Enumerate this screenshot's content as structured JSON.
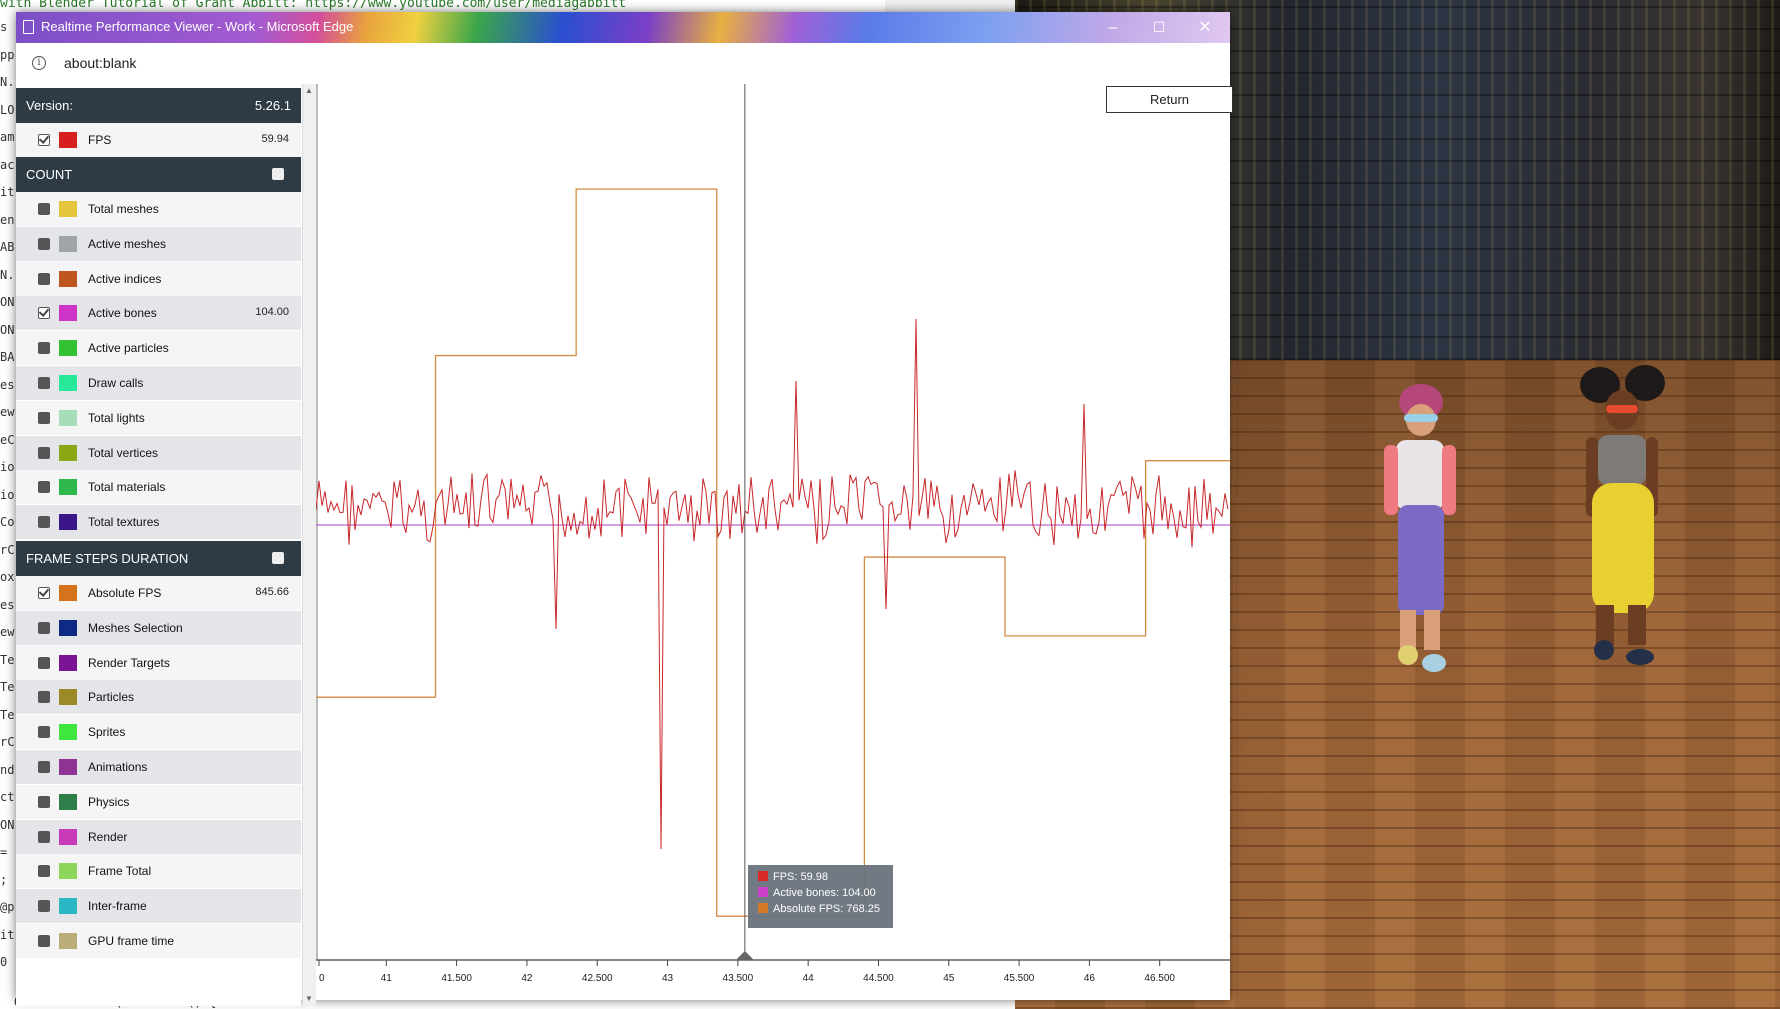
{
  "background": {
    "code_top_line": "with Blender Tutorial of Grant Abbitt: https://www.youtube.com/user/mediagabbitt",
    "code_bottom_line": "Observable.add(function () {",
    "code_left_fragments": [
      "s",
      "pp",
      "N.",
      "LO",
      "am",
      "ac",
      "it",
      "en",
      "AB",
      "N.",
      "ON",
      "ON",
      "BA",
      "es",
      "ew",
      "eC",
      "io",
      "io",
      "Co",
      "rC",
      "ox",
      "es",
      "ew",
      "Te",
      "Te",
      "Te",
      "rC",
      "nd",
      "ct",
      "ON",
      "=",
      ";",
      "@p",
      "it",
      "0"
    ]
  },
  "window": {
    "title": "Realtime Performance Viewer - Work - Microsoft Edge",
    "minimize_glyph": "–",
    "maximize_glyph": "☐",
    "close_glyph": "✕",
    "url": "about:blank",
    "info_glyph": "i"
  },
  "sidebar": {
    "version_label": "Version:",
    "version_value": "5.26.1",
    "fps": {
      "label": "FPS",
      "value": "59.94",
      "color": "#d81f1f",
      "checked": true
    },
    "count_header": "COUNT",
    "count_items": [
      {
        "label": "Total meshes",
        "value": "",
        "color": "#e3c43a",
        "checked": false
      },
      {
        "label": "Active meshes",
        "value": "",
        "color": "#9ea4a8",
        "checked": false
      },
      {
        "label": "Active indices",
        "value": "",
        "color": "#c0561f",
        "checked": false
      },
      {
        "label": "Active bones",
        "value": "104.00",
        "color": "#cc35c8",
        "checked": true
      },
      {
        "label": "Active particles",
        "value": "",
        "color": "#34c233",
        "checked": false
      },
      {
        "label": "Draw calls",
        "value": "",
        "color": "#28e89a",
        "checked": false
      },
      {
        "label": "Total lights",
        "value": "",
        "color": "#a6dcb8",
        "checked": false
      },
      {
        "label": "Total vertices",
        "value": "",
        "color": "#8aa814",
        "checked": false
      },
      {
        "label": "Total materials",
        "value": "",
        "color": "#30b84c",
        "checked": false
      },
      {
        "label": "Total textures",
        "value": "",
        "color": "#3a1588",
        "checked": false
      }
    ],
    "frame_header": "FRAME STEPS DURATION",
    "frame_items": [
      {
        "label": "Absolute FPS",
        "value": "845.66",
        "color": "#d4731c",
        "checked": true
      },
      {
        "label": "Meshes Selection",
        "value": "",
        "color": "#0f2a85",
        "checked": false
      },
      {
        "label": "Render Targets",
        "value": "",
        "color": "#7b1596",
        "checked": false
      },
      {
        "label": "Particles",
        "value": "",
        "color": "#9b8a27",
        "checked": false
      },
      {
        "label": "Sprites",
        "value": "",
        "color": "#3ee63e",
        "checked": false
      },
      {
        "label": "Animations",
        "value": "",
        "color": "#8e3495",
        "checked": false
      },
      {
        "label": "Physics",
        "value": "",
        "color": "#2e7e4a",
        "checked": false
      },
      {
        "label": "Render",
        "value": "",
        "color": "#c93ab8",
        "checked": false
      },
      {
        "label": "Frame Total",
        "value": "",
        "color": "#8ed65a",
        "checked": false
      },
      {
        "label": "Inter-frame",
        "value": "",
        "color": "#2bb6c4",
        "checked": false
      },
      {
        "label": "GPU frame time",
        "value": "",
        "color": "#b9ad7a",
        "checked": false
      }
    ]
  },
  "return_label": "Return",
  "tooltip": {
    "fps": "FPS: 59.98",
    "bones": "Active bones: 104.00",
    "abs": "Absolute FPS: 768.25"
  },
  "chart_data": {
    "type": "line",
    "x_ticks": [
      "0",
      "41",
      "41.500",
      "42",
      "42.500",
      "43",
      "43.500",
      "44",
      "44.500",
      "45",
      "45.500",
      "46",
      "46.500"
    ],
    "xlim": [
      40.5,
      47.0
    ],
    "cursor_x": 43.55,
    "series": [
      {
        "name": "FPS",
        "color": "#c8262a",
        "value_at_cursor": 59.98
      },
      {
        "name": "Active bones",
        "color": "#a640c6",
        "values_constant": 104.0
      },
      {
        "name": "Absolute FPS",
        "color": "#d28c44",
        "value_at_cursor": 768.25,
        "steps": [
          [
            40.5,
            0.3
          ],
          [
            41.35,
            0.69
          ],
          [
            42.35,
            0.88
          ],
          [
            43.35,
            0.05
          ],
          [
            44.4,
            0.46
          ],
          [
            45.4,
            0.37
          ],
          [
            46.4,
            0.57
          ],
          [
            47.0,
            0.57
          ]
        ]
      }
    ]
  }
}
